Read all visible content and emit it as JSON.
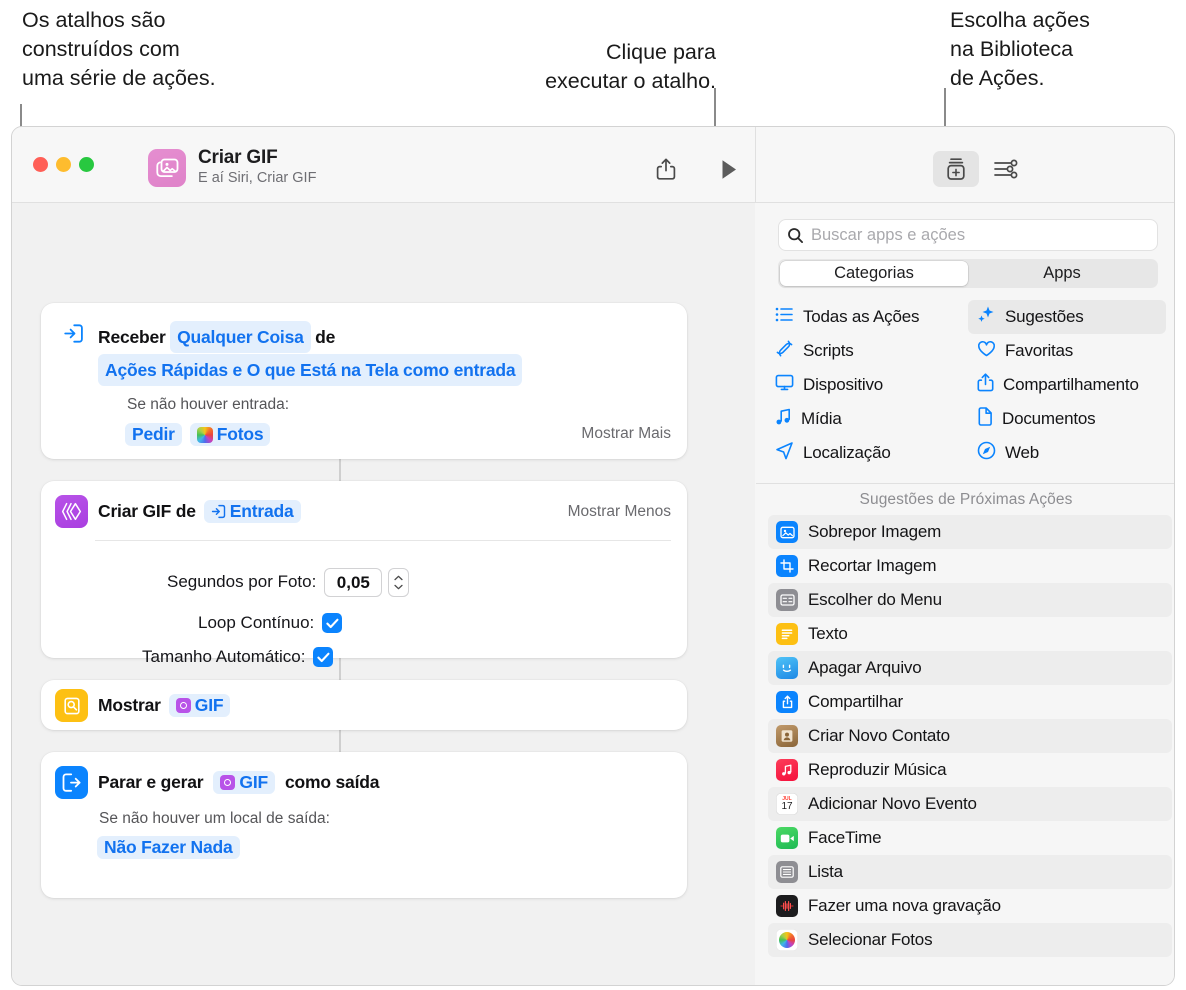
{
  "callouts": {
    "left": "Os atalhos são\nconstruídos com\numa série de ações.",
    "middle": "Clique para\nexecutar o atalho.",
    "right": "Escolha ações\nna Biblioteca\nde Ações."
  },
  "window": {
    "title": "Criar GIF",
    "subtitle": "E aí Siri, Criar GIF",
    "app_icon": "photos-stack-icon",
    "toolbar": {
      "share_label": "share-icon",
      "run_label": "play-icon",
      "library_label": "action-library-icon",
      "settings_label": "sliders-icon"
    }
  },
  "editor": {
    "actions": [
      {
        "icon": "receive-input-icon",
        "icon_style": "outline-blue",
        "title_parts": [
          {
            "type": "text",
            "value": "Receber"
          },
          {
            "type": "token",
            "value": "Qualquer Coisa"
          },
          {
            "type": "text",
            "value": "de"
          },
          {
            "type": "token",
            "value": "Ações Rápidas e O que Está na Tela como entrada"
          }
        ],
        "sub_label": "Se não houver entrada:",
        "sub_tokens": [
          {
            "value": "Pedir",
            "icon": ""
          },
          {
            "value": "Fotos",
            "icon": "photos-icon"
          }
        ],
        "show_toggle": "Mostrar Mais"
      },
      {
        "icon": "create-gif-icon",
        "icon_style": "purple",
        "title_text": "Criar GIF de",
        "title_token": "Entrada",
        "title_token_icon": "input-arrow-icon",
        "show_toggle": "Mostrar Menos",
        "params": [
          {
            "label": "Segundos por Foto:",
            "type": "stepper",
            "value": "0,05"
          },
          {
            "label": "Loop Contínuo:",
            "type": "checkbox",
            "checked": true
          },
          {
            "label": "Tamanho Automático:",
            "type": "checkbox",
            "checked": true
          }
        ]
      },
      {
        "icon": "quick-look-icon",
        "icon_style": "yellow",
        "title_text": "Mostrar",
        "title_token": "GIF",
        "title_token_icon": "gif-variable-icon"
      },
      {
        "icon": "stop-output-icon",
        "icon_style": "blue",
        "title_text": "Parar e gerar",
        "title_token": "GIF",
        "title_token_icon": "gif-variable-icon",
        "title_suffix": "como saída",
        "sub_label": "Se não houver um local de saída:",
        "sub_tokens": [
          {
            "value": "Não Fazer Nada",
            "icon": ""
          }
        ]
      }
    ]
  },
  "library": {
    "search": {
      "placeholder": "Buscar apps e ações",
      "icon": "search-icon"
    },
    "segmented": {
      "options": [
        "Categorias",
        "Apps"
      ],
      "selected": "Categorias"
    },
    "categories": [
      {
        "label": "Todas as Ações",
        "icon": "list-bullet-icon",
        "active": false
      },
      {
        "label": "Sugestões",
        "icon": "sparkles-icon",
        "active": true
      },
      {
        "label": "Scripts",
        "icon": "scroll-icon",
        "active": false
      },
      {
        "label": "Favoritas",
        "icon": "heart-icon",
        "active": false
      },
      {
        "label": "Dispositivo",
        "icon": "display-icon",
        "active": false
      },
      {
        "label": "Compartilhamento",
        "icon": "share-icon",
        "active": false
      },
      {
        "label": "Mídia",
        "icon": "music-note-icon",
        "active": false
      },
      {
        "label": "Documentos",
        "icon": "document-icon",
        "active": false
      },
      {
        "label": "Localização",
        "icon": "location-arrow-icon",
        "active": false
      },
      {
        "label": "Web",
        "icon": "compass-icon",
        "active": false
      }
    ],
    "suggestions_header": "Sugestões de Próximas Ações",
    "suggestions": [
      {
        "label": "Sobrepor Imagem",
        "icon": "overlay-image-icon",
        "color": "#0b84fe"
      },
      {
        "label": "Recortar Imagem",
        "icon": "crop-image-icon",
        "color": "#0b84fe"
      },
      {
        "label": "Escolher do Menu",
        "icon": "menu-choose-icon",
        "color": "#8e8e93"
      },
      {
        "label": "Texto",
        "icon": "text-icon",
        "color": "#fdc013"
      },
      {
        "label": "Apagar Arquivo",
        "icon": "finder-icon",
        "color": "#2e9cf0"
      },
      {
        "label": "Compartilhar",
        "icon": "share-icon",
        "color": "#0b84fe"
      },
      {
        "label": "Criar Novo Contato",
        "icon": "contacts-icon",
        "color": "#a87b4d"
      },
      {
        "label": "Reproduzir Música",
        "icon": "music-icon",
        "color": "#fa2d48"
      },
      {
        "label": "Adicionar Novo Evento",
        "icon": "calendar-icon",
        "color": "#ffffff"
      },
      {
        "label": "FaceTime",
        "icon": "facetime-icon",
        "color": "#34c759"
      },
      {
        "label": "Lista",
        "icon": "list-icon",
        "color": "#8e8e93"
      },
      {
        "label": "Fazer uma nova gravação",
        "icon": "voice-memos-icon",
        "color": "#1c1c1e"
      },
      {
        "label": "Selecionar Fotos",
        "icon": "photos-icon",
        "color": "#ffffff"
      }
    ]
  },
  "colors": {
    "accent_blue": "#0b84fe",
    "token_bg": "#e3effd",
    "purple": "#a93ee0",
    "yellow": "#fdc013"
  }
}
